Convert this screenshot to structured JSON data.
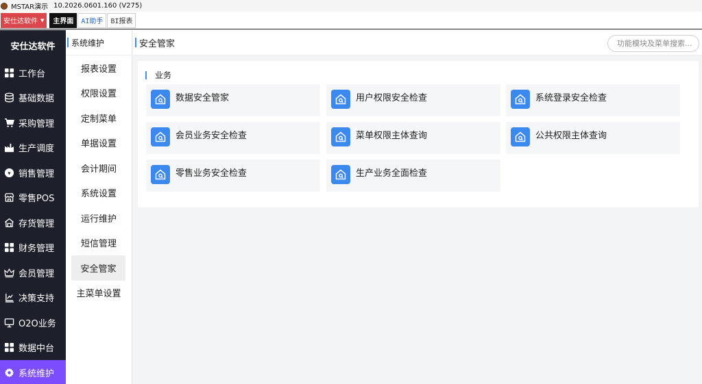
{
  "window": {
    "title": "MSTAR演示",
    "version": "10.2026.0601.160 (V275)"
  },
  "topbar": {
    "company": "安仕达软件",
    "tabs": [
      {
        "label": "主界面",
        "active": true
      },
      {
        "label": "AI助手",
        "active": false
      },
      {
        "label": "BI报表",
        "active": false
      }
    ]
  },
  "leftnav": {
    "brand": "安仕达软件",
    "items": [
      {
        "label": "工作台",
        "icon": "grid-icon"
      },
      {
        "label": "基础数据",
        "icon": "database-icon"
      },
      {
        "label": "采购管理",
        "icon": "cart-icon"
      },
      {
        "label": "生产调度",
        "icon": "factory-icon"
      },
      {
        "label": "销售管理",
        "icon": "sales-icon"
      },
      {
        "label": "零售POS",
        "icon": "store-icon"
      },
      {
        "label": "存货管理",
        "icon": "warehouse-icon"
      },
      {
        "label": "财务管理",
        "icon": "grid-icon"
      },
      {
        "label": "会员管理",
        "icon": "crown-icon"
      },
      {
        "label": "决策支持",
        "icon": "decision-icon"
      },
      {
        "label": "O2O业务",
        "icon": "monitor-icon"
      },
      {
        "label": "数据中台",
        "icon": "grid-icon"
      },
      {
        "label": "系统维护",
        "icon": "gear-icon",
        "active": true
      }
    ]
  },
  "subnav": {
    "title": "系统维护",
    "items": [
      {
        "label": "报表设置"
      },
      {
        "label": "权限设置"
      },
      {
        "label": "定制菜单"
      },
      {
        "label": "单据设置"
      },
      {
        "label": "会计期间"
      },
      {
        "label": "系统设置"
      },
      {
        "label": "运行维护"
      },
      {
        "label": "短信管理"
      },
      {
        "label": "安全管家",
        "active": true
      },
      {
        "label": "主菜单设置"
      }
    ]
  },
  "content": {
    "title": "安全管家",
    "search_placeholder": "功能模块及菜单搜索...",
    "section": {
      "title": "业务",
      "cards": [
        {
          "label": "数据安全管家",
          "icon": "house-icon"
        },
        {
          "label": "用户权限安全检查",
          "icon": "house-icon"
        },
        {
          "label": "系统登录安全检查",
          "icon": "house-icon"
        },
        {
          "label": "会员业务安全检查",
          "icon": "house-icon"
        },
        {
          "label": "菜单权限主体查询",
          "icon": "house-icon"
        },
        {
          "label": "公共权限主体查询",
          "icon": "house-icon"
        },
        {
          "label": "零售业务安全检查",
          "icon": "house-icon"
        },
        {
          "label": "生产业务全面检查",
          "icon": "house-icon"
        }
      ]
    }
  },
  "colors": {
    "accent": "#3d8ef0",
    "nav_bg": "#1d1f2b",
    "nav_active": "#7c4dff",
    "company_btn": "#d9464b",
    "card_icon": "#3b88ef"
  }
}
